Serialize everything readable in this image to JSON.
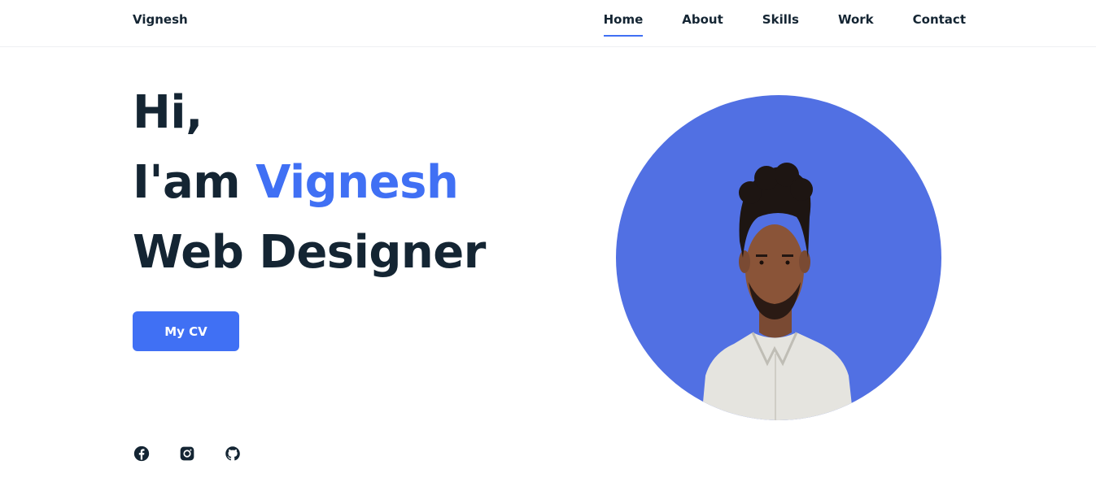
{
  "header": {
    "logo": "Vignesh",
    "nav": [
      {
        "label": "Home",
        "active": true
      },
      {
        "label": "About",
        "active": false
      },
      {
        "label": "Skills",
        "active": false
      },
      {
        "label": "Work",
        "active": false
      },
      {
        "label": "Contact",
        "active": false
      }
    ]
  },
  "hero": {
    "greeting": "Hi,",
    "intro_prefix": "I'am ",
    "name": "Vignesh",
    "role": "Web Designer",
    "cv_button": "My CV"
  },
  "socials": [
    {
      "icon": "facebook-icon"
    },
    {
      "icon": "instagram-icon"
    },
    {
      "icon": "github-icon"
    }
  ],
  "colors": {
    "accent": "#4070f4",
    "text": "#142533",
    "portrait_bg": "#5170e3"
  }
}
